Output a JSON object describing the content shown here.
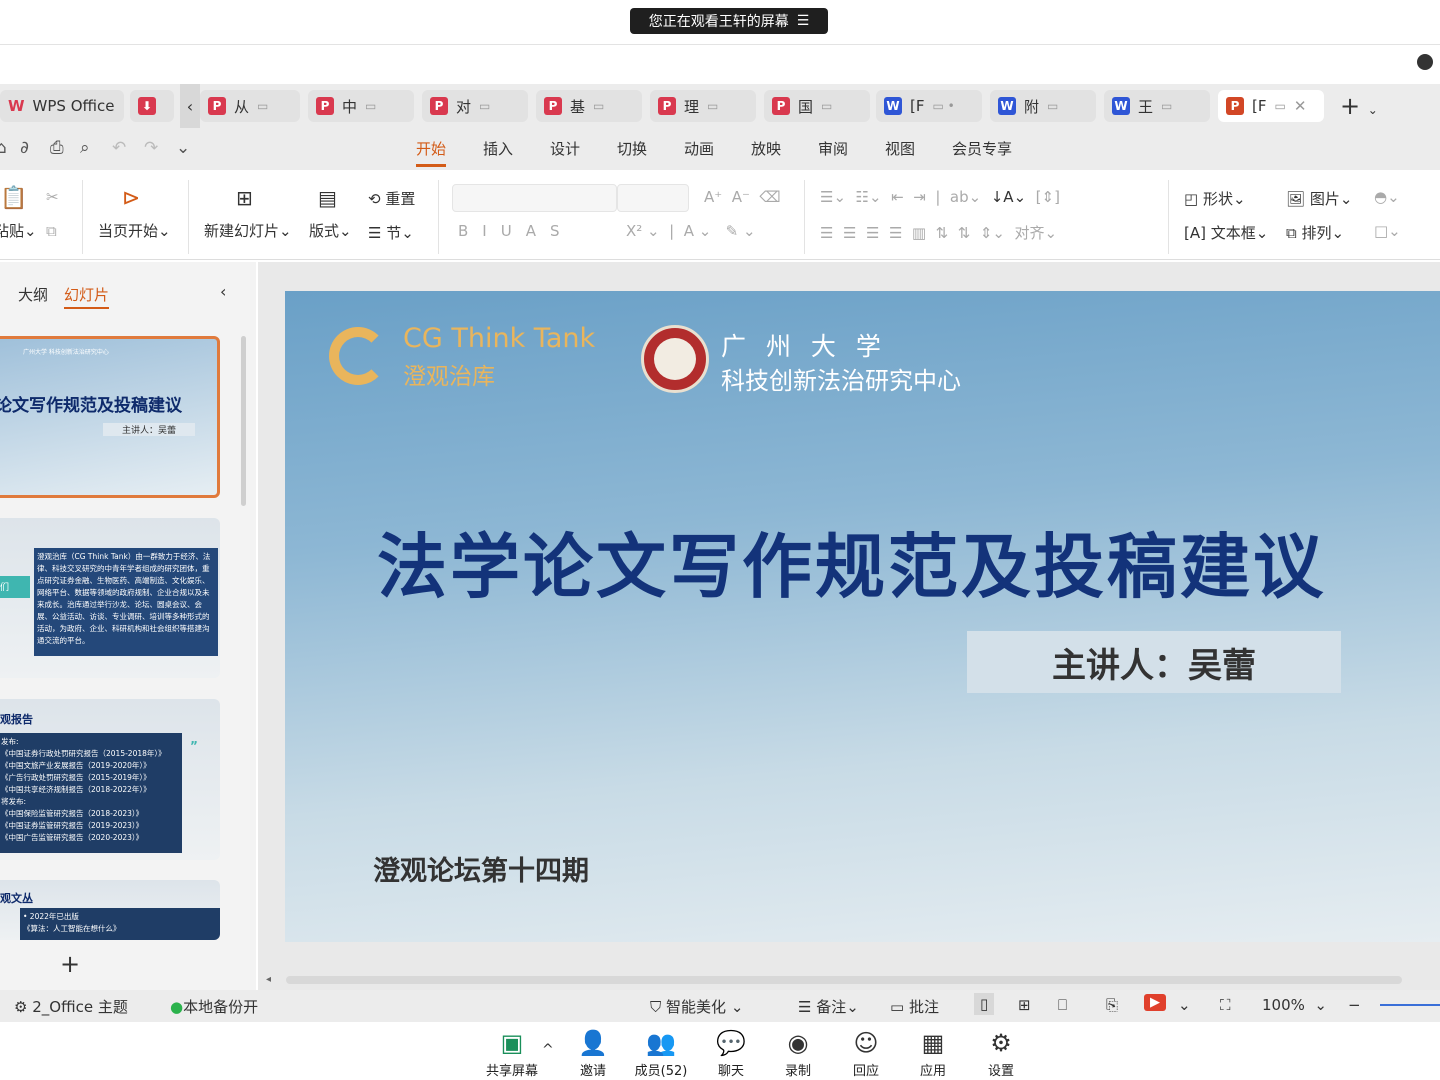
{
  "banner": {
    "text": "您正在观看王轩的屏幕",
    "menu_icon": "menu-lines-icon"
  },
  "tabs": [
    {
      "label": "WPS Office",
      "type": "home"
    },
    {
      "label": "",
      "type": "pdf"
    },
    {
      "label": "从",
      "type": "p"
    },
    {
      "label": "中",
      "type": "p"
    },
    {
      "label": "对",
      "type": "p"
    },
    {
      "label": "基",
      "type": "p"
    },
    {
      "label": "理",
      "type": "p"
    },
    {
      "label": "国",
      "type": "p"
    },
    {
      "label": "[F",
      "type": "w"
    },
    {
      "label": "附",
      "type": "w"
    },
    {
      "label": "王",
      "type": "w"
    },
    {
      "label": "[F",
      "type": "pp",
      "active": true
    }
  ],
  "menu": [
    "开始",
    "插入",
    "设计",
    "切换",
    "动画",
    "放映",
    "审阅",
    "视图",
    "会员专享"
  ],
  "ribbon": {
    "paste": "粘贴",
    "from_current": "当页开始",
    "new_slide": "新建幻灯片",
    "layout": "版式",
    "reset": "重置",
    "section": "节",
    "align": "对齐",
    "shape": "形状",
    "picture": "图片",
    "textbox": "文本框",
    "arrange": "排列"
  },
  "panel": {
    "tab_outline": "大纲",
    "tab_slides": "幻灯片",
    "add": "+"
  },
  "thumbs": {
    "t1_title": "论文写作规范及投稿建议",
    "t1_speaker": "主讲人：吴蕾",
    "t1_org": "广州大学 科技创新法治研究中心",
    "t2_label": "们",
    "t2_text": "澄观治库（CG Think Tank）由一群致力于经济、法律、科技交叉研究的中青年学者组成的研究团体，重点研究证券金融、生物医药、高端制造、文化娱乐、网络平台、数据等领域的政府规制、企业合规以及未来成长。治库通过举行沙龙、论坛、圆桌会议、会展、公益活动、访谈、专业调研、培训等多种形式的活动，为政府、企业、科研机构和社会组织等搭建沟通交流的平台。",
    "t3_title": "观报告",
    "t3_lines": [
      "发布:",
      "《中国证券行政处罚研究报告（2015-2018年）》",
      "《中国文旅产业发展报告（2019-2020年）》",
      "《广告行政处罚研究报告（2015-2019年）》",
      "《中国共享经济规制报告（2018-2022年）》",
      "将发布:",
      "《中国保险监管研究报告（2018-2023）》",
      "《中国证券监管研究报告（2019-2023）》",
      "《中国广告监管研究报告（2020-2023）》"
    ],
    "t4_title": "观文丛",
    "t4_lines": [
      "• 2022年已出版",
      "《算法：人工智能在想什么》"
    ]
  },
  "slide": {
    "logo_en": "CG Think Tank",
    "logo_cn": "澄观治库",
    "uni_name": "广 州 大 学",
    "uni_center": "科技创新法治研究中心",
    "title": "法学论文写作规范及投稿建议",
    "speaker": "主讲人：吴蕾",
    "forum": "澄观论坛第十四期",
    "accent": "#e9b55c",
    "title_color": "#13337a"
  },
  "status": {
    "theme": "2_Office 主题",
    "backup": "本地备份开",
    "beautify": "智能美化",
    "notes": "备注",
    "comment": "批注",
    "zoom": "100%"
  },
  "meeting": [
    {
      "label": "共享屏幕",
      "icon": "share-screen-icon"
    },
    {
      "label": "邀请",
      "icon": "invite-icon"
    },
    {
      "label": "成员(52)",
      "icon": "members-icon"
    },
    {
      "label": "聊天",
      "icon": "chat-icon"
    },
    {
      "label": "录制",
      "icon": "record-icon"
    },
    {
      "label": "回应",
      "icon": "reaction-icon"
    },
    {
      "label": "应用",
      "icon": "apps-icon"
    },
    {
      "label": "设置",
      "icon": "settings-icon"
    }
  ]
}
